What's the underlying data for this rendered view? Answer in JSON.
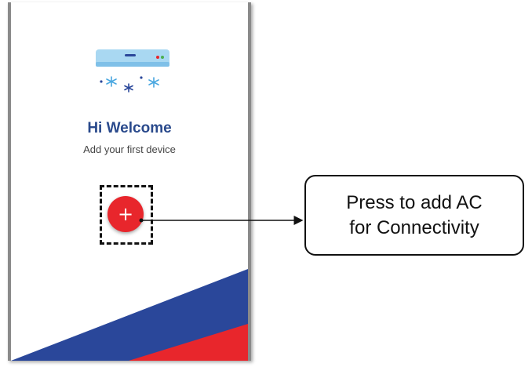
{
  "screen": {
    "welcome_title": "Hi Welcome",
    "welcome_subtitle": "Add your first device",
    "add_button_icon": "plus-icon",
    "illustration_icon": "air-conditioner-icon"
  },
  "callout": {
    "line1": "Press to add AC",
    "line2": "for Connectivity"
  },
  "colors": {
    "title": "#2a4a8c",
    "add_button": "#e8262c",
    "stripe_blue": "#2a479a",
    "stripe_red": "#e8262c",
    "ac_body": "#a9d8f2",
    "snowflake": "#4aa7e0"
  }
}
